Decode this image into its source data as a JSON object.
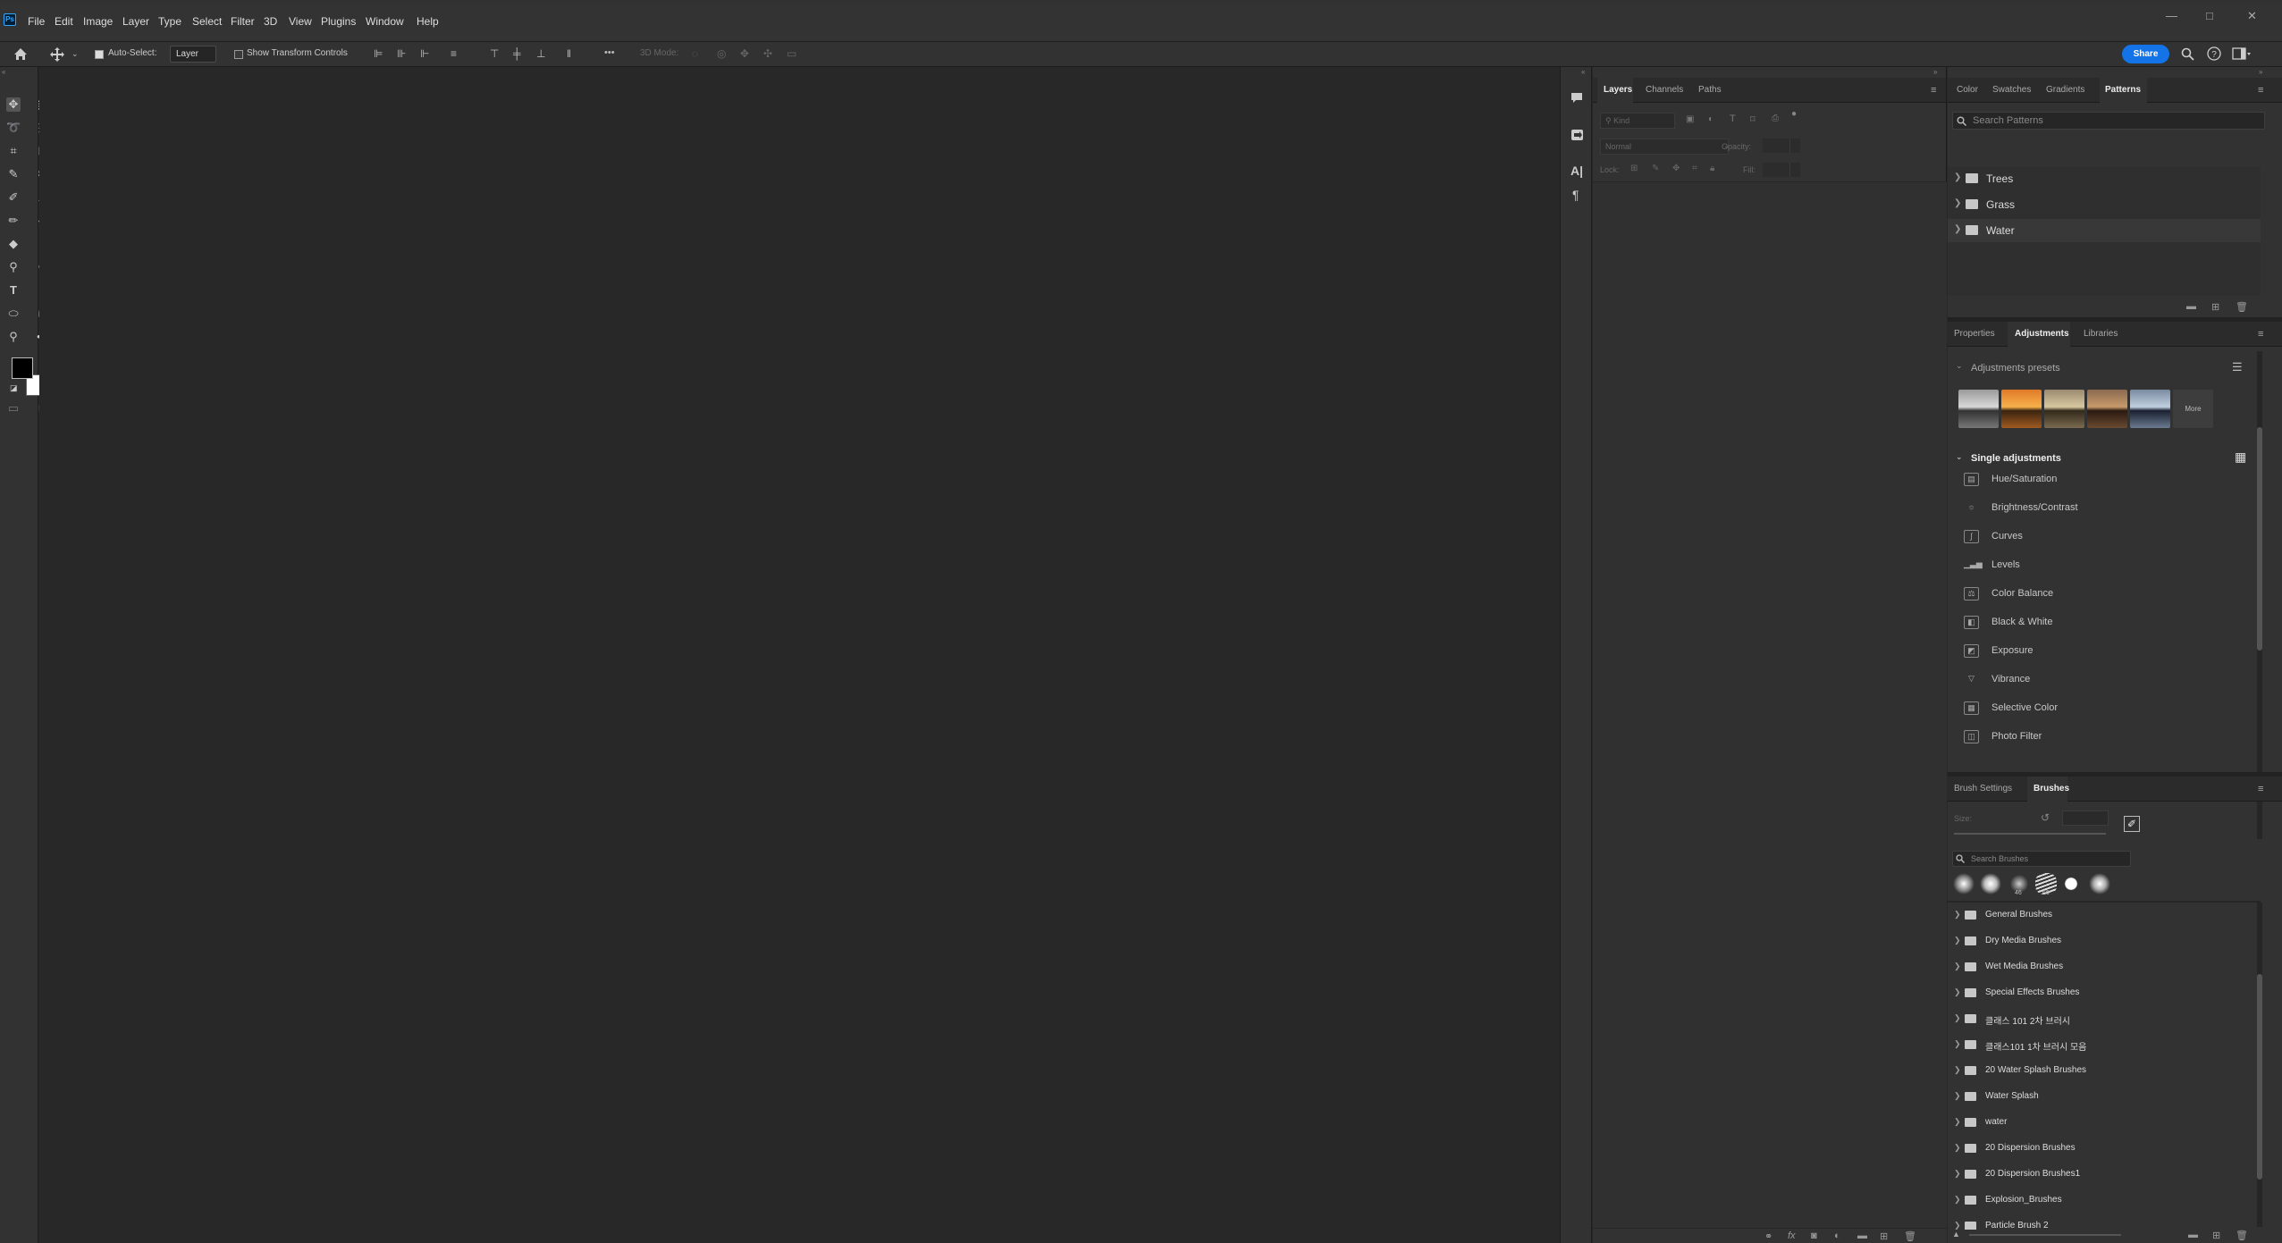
{
  "menubar": {
    "app_logo": "Ps",
    "items": [
      "File",
      "Edit",
      "Image",
      "Layer",
      "Type",
      "Select",
      "Filter",
      "3D",
      "View",
      "Plugins",
      "Window",
      "Help"
    ],
    "window_controls": {
      "minimize": "—",
      "maximize": "□",
      "close": "✕"
    }
  },
  "options_bar": {
    "home_icon": "home-icon",
    "auto_select_label": "Auto-Select:",
    "auto_select_checked": true,
    "auto_select_target": "Layer",
    "show_transform_label": "Show Transform Controls",
    "show_transform_checked": false,
    "more_label": "•••",
    "mode_3d_label": "3D Mode:",
    "share_label": "Share",
    "share_color": "#1473e6"
  },
  "layers_panel": {
    "tabs": [
      "Layers",
      "Channels",
      "Paths"
    ],
    "active_tab": "Layers",
    "kind_placeholder": "Kind",
    "blend_mode": "Normal",
    "opacity_label": "Opacity:",
    "lock_label": "Lock:",
    "fill_label": "Fill:"
  },
  "patterns_panel": {
    "tabs": [
      "Color",
      "Swatches",
      "Gradients",
      "Patterns"
    ],
    "active_tab": "Patterns",
    "search_placeholder": "Search Patterns",
    "folders": [
      "Trees",
      "Grass",
      "Water"
    ]
  },
  "adjustments_panel": {
    "tabs": [
      "Properties",
      "Adjustments",
      "Libraries"
    ],
    "active_tab": "Adjustments",
    "presets_heading": "Adjustments presets",
    "more_label": "More",
    "single_heading": "Single adjustments",
    "items": [
      "Hue/Saturation",
      "Brightness/Contrast",
      "Curves",
      "Levels",
      "Color Balance",
      "Black & White",
      "Exposure",
      "Vibrance",
      "Selective Color",
      "Photo Filter"
    ]
  },
  "brushes_panel": {
    "tabs": [
      "Brush Settings",
      "Brushes"
    ],
    "active_tab": "Brushes",
    "size_label": "Size:",
    "search_placeholder": "Search Brushes",
    "tip_sizes": [
      "46",
      "60"
    ],
    "folders": [
      "General Brushes",
      "Dry Media Brushes",
      "Wet Media Brushes",
      "Special Effects Brushes",
      "클래스 101 2차 브러시",
      "클래스101 1차 브러시 모음",
      "20 Water Splash Brushes",
      "Water Splash",
      "water",
      "20 Dispersion Brushes",
      "20 Dispersion Brushes1",
      "Explosion_Brushes",
      "Particle Brush 2"
    ]
  }
}
